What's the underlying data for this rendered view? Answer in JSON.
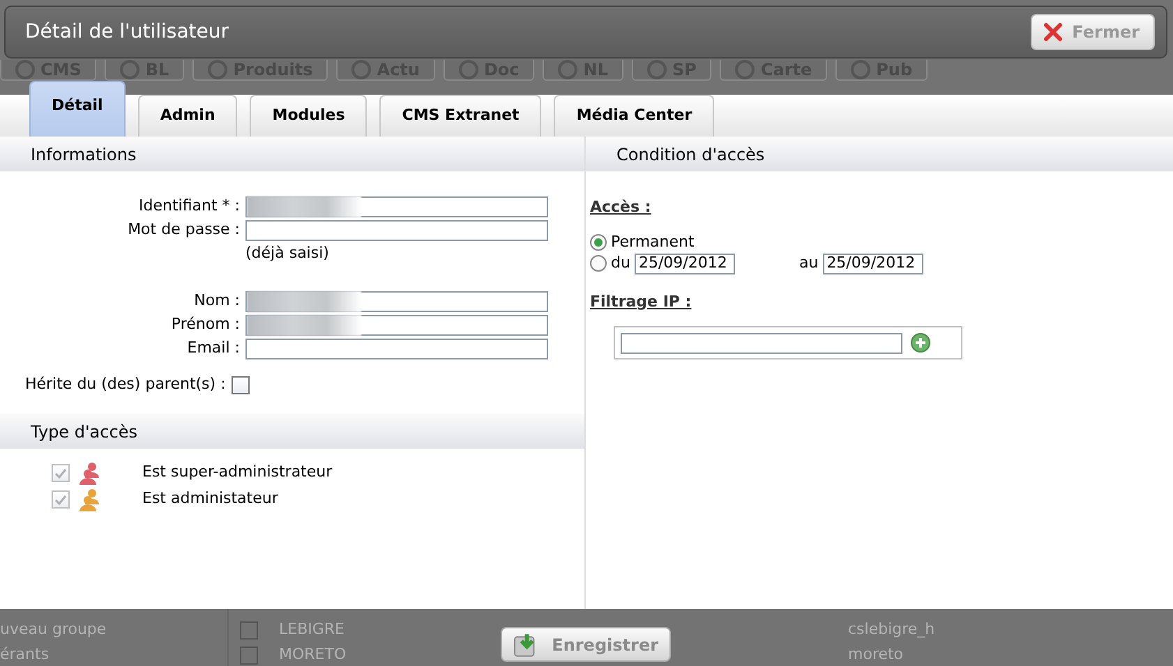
{
  "background": {
    "nav_items": [
      {
        "label": "CMS"
      },
      {
        "label": "BL"
      },
      {
        "label": "Produits"
      },
      {
        "label": "Actu"
      },
      {
        "label": "Doc"
      },
      {
        "label": "NL"
      },
      {
        "label": "SP"
      },
      {
        "label": "Carte"
      },
      {
        "label": "Pub"
      }
    ],
    "rows": [
      {
        "group": "uveau groupe",
        "checked": false,
        "name": "LEBIGRE",
        "login": "cslebigre_h"
      },
      {
        "group": "érants",
        "checked": false,
        "name": "MORETO",
        "login": "moreto"
      }
    ]
  },
  "dialog": {
    "title": "Détail de l'utilisateur",
    "close_button": "Fermer",
    "tabs": [
      {
        "label": "Détail",
        "selected": true
      },
      {
        "label": "Admin",
        "selected": false
      },
      {
        "label": "Modules",
        "selected": false
      },
      {
        "label": "CMS Extranet",
        "selected": false
      },
      {
        "label": "Média Center",
        "selected": false
      }
    ],
    "informations": {
      "header": "Informations",
      "fields": [
        {
          "label": "Identifiant * :",
          "redacted": true
        },
        {
          "label": "Mot de passe :",
          "redacted": false,
          "note": "(déjà saisi)"
        },
        {
          "label": "Nom :",
          "redacted": true
        },
        {
          "label": "Prénom :",
          "redacted": true
        },
        {
          "label": "Email :",
          "redacted": false
        }
      ],
      "inherit": {
        "label": "Hérite du (des) parent(s) :",
        "checked": false
      }
    },
    "access_type": {
      "header": "Type d'accès",
      "items": [
        {
          "label": "Est super-administrateur",
          "checked": true,
          "disabled": true,
          "color": "#e0606a"
        },
        {
          "label": "Est administateur",
          "checked": true,
          "disabled": true,
          "color": "#e8a33a"
        }
      ]
    },
    "conditions": {
      "header": "Condition d'accès",
      "access_label": "Accès :",
      "options": [
        {
          "kind": "plain",
          "label": "Permanent",
          "selected": true
        },
        {
          "kind": "range",
          "label": "du",
          "selected": false,
          "from": "25/09/2012",
          "to_label": "au",
          "to": "25/09/2012"
        }
      ],
      "ip_label": "Filtrage IP :"
    },
    "save_button": "Enregistrer"
  }
}
